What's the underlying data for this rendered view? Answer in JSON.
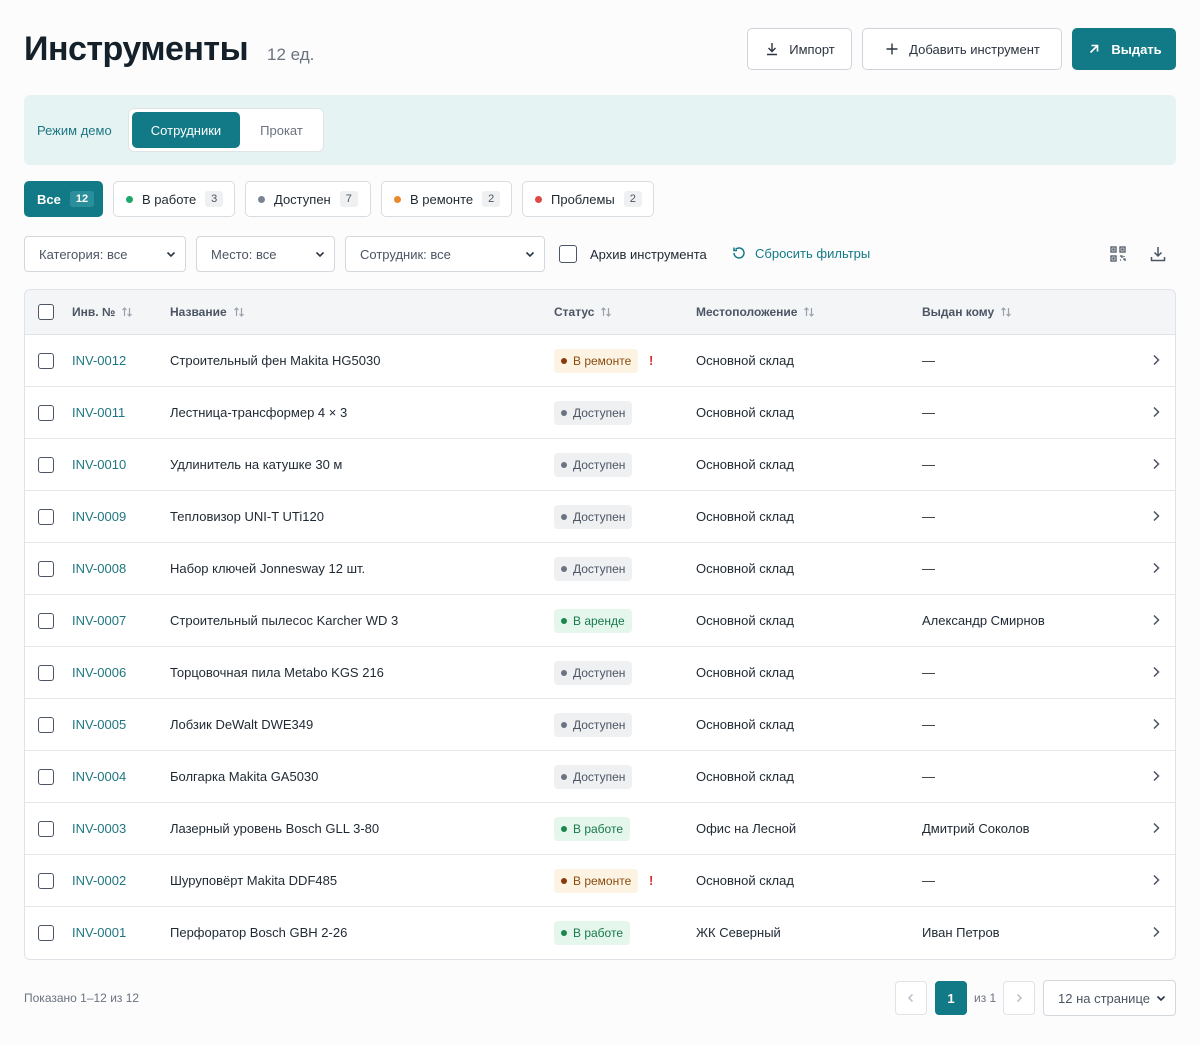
{
  "header": {
    "title": "Инструменты",
    "count": "12 ед.",
    "import_label": "Импорт",
    "add_label": "Добавить инструмент",
    "issue_label": "Выдать"
  },
  "demo": {
    "label": "Режим демо",
    "segments": [
      "Сотрудники",
      "Прокат"
    ],
    "active": "Сотрудники"
  },
  "chips": [
    {
      "label": "Все",
      "count": "12",
      "color": ""
    },
    {
      "label": "В работе",
      "count": "3",
      "color": "#1fa86a"
    },
    {
      "label": "Доступен",
      "count": "7",
      "color": "#7a8593"
    },
    {
      "label": "В ремонте",
      "count": "2",
      "color": "#e8892b"
    },
    {
      "label": "Проблемы",
      "count": "2",
      "color": "#e04848"
    }
  ],
  "filters": {
    "category": "Категория: все",
    "place": "Место: все",
    "employee": "Сотрудник: все",
    "archive_label": "Архив инструмента",
    "reset_label": "Сбросить фильтры"
  },
  "table": {
    "columns": [
      "Инв. №",
      "Название",
      "Статус",
      "Местоположение",
      "Выдан кому"
    ],
    "rows": [
      {
        "id": "INV-0012",
        "name": "Строительный фен Makita HG5030",
        "status": "В ремонте",
        "status_kind": "repair",
        "alert": "!",
        "location": "Основной склад",
        "assignee": "—"
      },
      {
        "id": "INV-0011",
        "name": "Лестница-трансформер 4 × 3",
        "status": "Доступен",
        "status_kind": "available",
        "alert": "",
        "location": "Основной склад",
        "assignee": "—"
      },
      {
        "id": "INV-0010",
        "name": "Удлинитель на катушке 30 м",
        "status": "Доступен",
        "status_kind": "available",
        "alert": "",
        "location": "Основной склад",
        "assignee": "—"
      },
      {
        "id": "INV-0009",
        "name": "Тепловизор UNI-T UTi120",
        "status": "Доступен",
        "status_kind": "available",
        "alert": "",
        "location": "Основной склад",
        "assignee": "—"
      },
      {
        "id": "INV-0008",
        "name": "Набор ключей Jonnesway 12 шт.",
        "status": "Доступен",
        "status_kind": "available",
        "alert": "",
        "location": "Основной склад",
        "assignee": "—"
      },
      {
        "id": "INV-0007",
        "name": "Строительный пылесос Karcher WD 3",
        "status": "В аренде",
        "status_kind": "active",
        "alert": "",
        "location": "Основной склад",
        "assignee": "Александр Смирнов"
      },
      {
        "id": "INV-0006",
        "name": "Торцовочная пила Metabo KGS 216",
        "status": "Доступен",
        "status_kind": "available",
        "alert": "",
        "location": "Основной склад",
        "assignee": "—"
      },
      {
        "id": "INV-0005",
        "name": "Лобзик DeWalt DWE349",
        "status": "Доступен",
        "status_kind": "available",
        "alert": "",
        "location": "Основной склад",
        "assignee": "—"
      },
      {
        "id": "INV-0004",
        "name": "Болгарка Makita GA5030",
        "status": "Доступен",
        "status_kind": "available",
        "alert": "",
        "location": "Основной склад",
        "assignee": "—"
      },
      {
        "id": "INV-0003",
        "name": "Лазерный уровень Bosch GLL 3-80",
        "status": "В работе",
        "status_kind": "active",
        "alert": "",
        "location": "Офис на Лесной",
        "assignee": "Дмитрий Соколов"
      },
      {
        "id": "INV-0002",
        "name": "Шуруповёрт Makita DDF485",
        "status": "В ремонте",
        "status_kind": "repair",
        "alert": "!",
        "location": "Основной склад",
        "assignee": "—"
      },
      {
        "id": "INV-0001",
        "name": "Перфоратор Bosch GBH 2-26",
        "status": "В работе",
        "status_kind": "active",
        "alert": "",
        "location": "ЖК Северный",
        "assignee": "Иван Петров"
      }
    ]
  },
  "footer": {
    "shown": "Показано 1–12 из 12",
    "page": "1",
    "of": "из 1",
    "per_page": "12 на странице"
  },
  "colors": {
    "accent": "#127a86",
    "available_bg": "#eef0f2",
    "available_fg": "#4b5563",
    "active_bg": "#e5f6ec",
    "active_fg": "#17794a",
    "repair_bg": "#fdf3e3",
    "repair_fg": "#8a4b0f"
  }
}
